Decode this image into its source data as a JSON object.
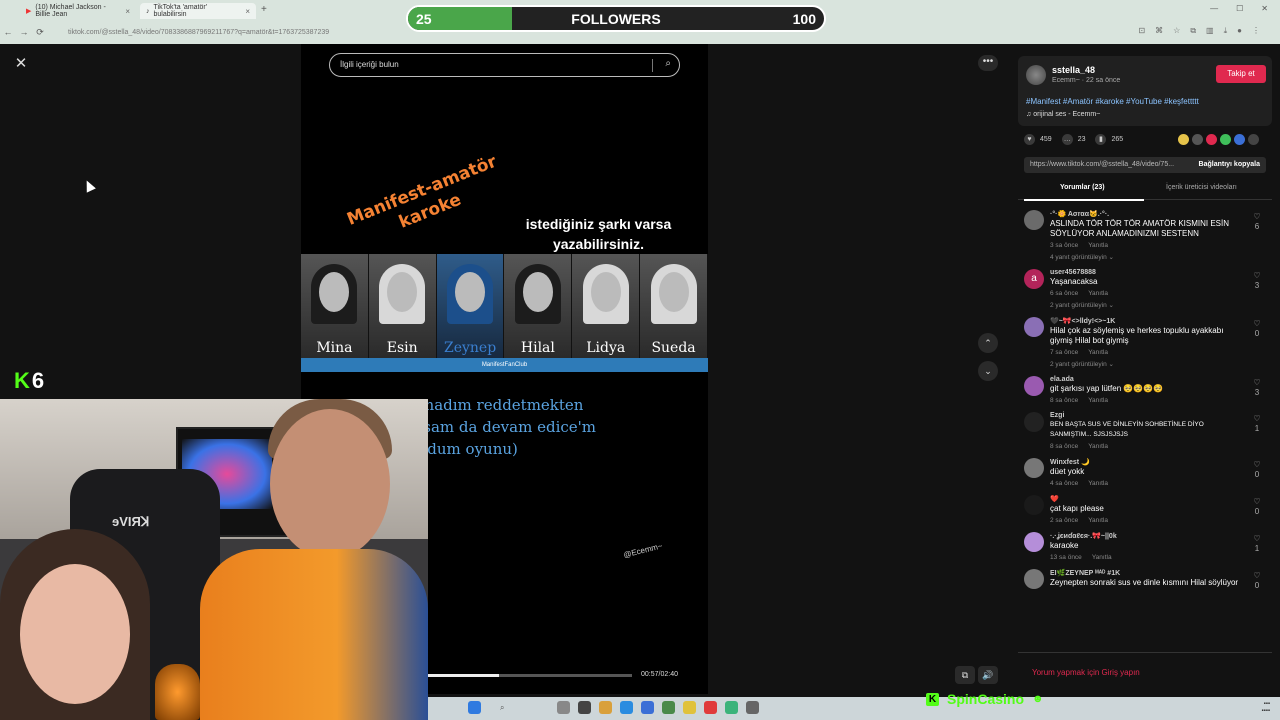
{
  "browser": {
    "tabs": [
      {
        "label": "(10) Michael Jackson - Billie Jean",
        "icon": "youtube-icon"
      },
      {
        "label": "TikTok'ta 'amatör' bulabilirsin",
        "icon": "tiktok-icon"
      }
    ],
    "new_tab": "+",
    "url": "tiktok.com/@sstella_48/video/7083386887969211767?q=amatör&t=1763725387239"
  },
  "overlay": {
    "followers_current": "25",
    "followers_label": "FOLLOWERS",
    "followers_goal": "100",
    "followers_progress": 0.25,
    "kick_prefix": "K",
    "kick_number": "6",
    "sponsor": "SpinCasino"
  },
  "video": {
    "search_placeholder": "İlgili içeriği bulun",
    "title_art": "Manifest-amatör karoke",
    "request_text": "istediğiniz şarkı varsa yazabilirsiniz.",
    "members": [
      "Mina",
      "Esin",
      "Zeynep",
      "Hilal",
      "Lidya",
      "Sueda"
    ],
    "fanclub": "ManifestFanClub",
    "lyrics": "Dayanamadım reddetmekten\nKorktuysam da devam edice'm\nYine bozdum oyunu)",
    "watermark": "@Ecemm~",
    "timecode": "00:57/02:40",
    "progress": 0.35
  },
  "post": {
    "username": "sstella_48",
    "meta": "Ecemm~ · 22 sa önce",
    "follow_label": "Takip et",
    "hashtags": "#Manifest #Amatör #karoke #YouTube #keşfettttt",
    "sound": "♫  orijinal ses - Ecemm~",
    "likes": "459",
    "comments_count": "23",
    "saves": "265",
    "link": "https://www.tiktok.com/@sstella_48/video/75...",
    "copy_label": "Bağlantıyı kopyala",
    "tab_comments": "Yorumlar (23)",
    "tab_creator": "İçerik üreticisi videoları",
    "login_prompt": "Yorum yapmak için Giriş yapın"
  },
  "comments": [
    {
      "user": "·°·🌼 Ασrαα🐱.·°·.",
      "text": "ASLINDA TÖR TÖR TÖR AMATÖR KISMINI ESİN SÖYLÜYOR ANLAMADINIZMI SESTENN",
      "time": "3 sa önce",
      "reply": "Yanıtla",
      "more": "4 yanıt görüntüleyin ⌄",
      "likes": "6",
      "avatar": "",
      "color": "#6b6b6b"
    },
    {
      "user": "user45678888",
      "text": "Yaşanacaksa",
      "time": "6 sa önce",
      "reply": "Yanıtla",
      "more": "2 yanıt görüntüleyin ⌄",
      "likes": "3",
      "avatar": "a",
      "color": "#b3245a"
    },
    {
      "user": "🖤~🎀<>lldy!<>~1K",
      "text": "Hilal çok az söylemiş ve herkes topuklu ayakkabı giymiş Hilal bot giymiş",
      "time": "7 sa önce",
      "reply": "Yanıtla",
      "more": "2 yanıt görüntüleyin ⌄",
      "likes": "0",
      "avatar": "",
      "color": "#8a6fb5"
    },
    {
      "user": "ela.ada",
      "text": "git şarkısı yap lütfen 🥺🥺🥺🥺",
      "time": "8 sa önce",
      "reply": "Yanıtla",
      "more": "",
      "likes": "3",
      "avatar": "",
      "color": "#9a5ab0"
    },
    {
      "user": "Ezgi",
      "text": "BEN BAŞTA SUS VE DİNLEYİN SOHBETİNLE DİYO SANMIŞTIM... SJSJSJSJS",
      "time": "8 sa önce",
      "reply": "Yanıtla",
      "more": "",
      "likes": "1",
      "avatar": "",
      "color": "#222222"
    },
    {
      "user": "Winxfest 🌙",
      "text": "düet yokk",
      "time": "4 sa önce",
      "reply": "Yanıtla",
      "more": "",
      "likes": "0",
      "avatar": "",
      "color": "#777777"
    },
    {
      "user": "❤️",
      "text": "çat kapı please",
      "time": "2 sa önce",
      "reply": "Yanıtla",
      "more": "",
      "likes": "0",
      "avatar": "",
      "color": "#1a1a1a"
    },
    {
      "user": "·.·ʝєиɗαℓєя·.🎀~||0k",
      "text": "karaoke",
      "time": "13 sa önce",
      "reply": "Yanıtla",
      "more": "",
      "likes": "1",
      "avatar": "",
      "color": "#b58ed9"
    },
    {
      "user": "EI🌿ZEYNEP ᴹᴬᴰ #1K",
      "text": "Zeynepten sonraki sus ve dinle kısmını Hilal söylüyor",
      "time": "",
      "reply": "",
      "more": "",
      "likes": "0",
      "avatar": "",
      "color": "#777777"
    }
  ]
}
